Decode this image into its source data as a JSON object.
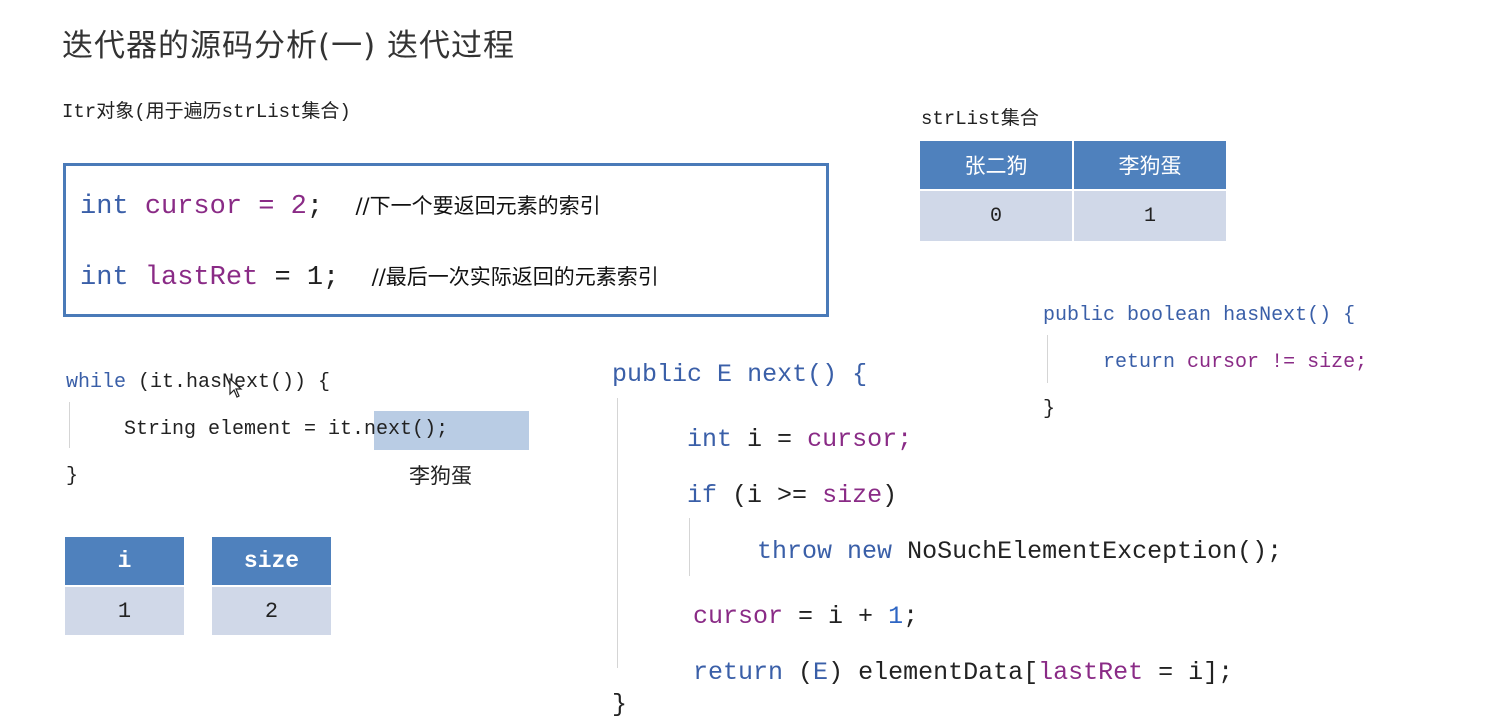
{
  "title": "迭代器的源码分析(一)  迭代过程",
  "itr_caption": "Itr对象(用于遍历strList集合)",
  "fields": {
    "cursor": {
      "type": "int",
      "name": "cursor",
      "op": "=",
      "value": "2",
      "semi": ";",
      "comment": "//下一个要返回元素的索引"
    },
    "lastRet": {
      "type": "int",
      "name": "lastRet",
      "op": "=",
      "value": "1",
      "semi": ";",
      "comment": "//最后一次实际返回的元素索引"
    }
  },
  "strlist": {
    "caption": "strList集合",
    "headers": [
      "张二狗",
      "李狗蛋"
    ],
    "indices": [
      "0",
      "1"
    ]
  },
  "loop_code": {
    "line1_kw": "while",
    "line1_rest": " (it.hasNext()) {",
    "line2_pre": "String element = ",
    "line2_call": "it.next();",
    "line3": "}",
    "result_label": "李狗蛋"
  },
  "vars_table": {
    "i_header": "i",
    "i_value": "1",
    "size_header": "size",
    "size_value": "2"
  },
  "hasnext_code": {
    "public": "public",
    "boolean": "boolean",
    "signature": "hasNext() {",
    "return": "return",
    "cursor": "cursor",
    "ne": "!=",
    "size": "size;",
    "close": "}"
  },
  "next_code": {
    "public": "public",
    "E": "E",
    "signature": "next() {",
    "l1_int": "int",
    "l1_i": "i =",
    "l1_cursor": "cursor;",
    "l2_if": "if",
    "l2_open": "(i >=",
    "l2_size": "size",
    "l2_close": ")",
    "l3_throw": "throw",
    "l3_new": "new",
    "l3_exc": "NoSuchElementException();",
    "l4_cursor": "cursor",
    "l4_mid": "= i +",
    "l4_one": "1",
    "l4_semi": ";",
    "l5_return": "return",
    "l5_open": "(",
    "l5_E": "E",
    "l5_mid": ") elementData[",
    "l5_lastRet": "lastRet",
    "l5_end": "= i];",
    "close": "}"
  },
  "colors": {
    "keyword": "#3a5fa8",
    "variable": "#8a2b86",
    "number": "#2e66c4",
    "table_header": "#4f81bd",
    "table_cell": "#d0d8e8",
    "box_border": "#4a7ab8",
    "highlight": "#b9cce4"
  },
  "icons": {
    "mouse_cursor": "arrow-pointer-icon"
  }
}
